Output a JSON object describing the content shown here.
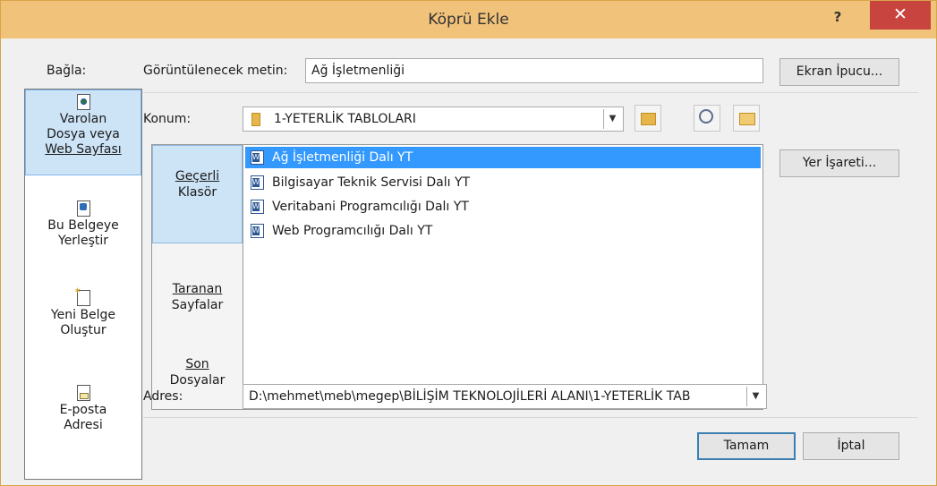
{
  "window": {
    "title": "Köprü Ekle",
    "help_label": "?",
    "close_label": "✕"
  },
  "link_to": {
    "heading": "Bağla:",
    "items": [
      {
        "line1": "Varolan",
        "line2": "Dosya veya",
        "line3": "Web Sayfası",
        "icon": "existing-file-icon",
        "selected": true
      },
      {
        "line1": "Bu Belgeye",
        "line2": "Yerleştir",
        "icon": "place-in-document-icon"
      },
      {
        "line1": "Yeni Belge",
        "line2": "Oluştur",
        "icon": "new-document-icon"
      },
      {
        "line1": "E-posta",
        "line2": "Adresi",
        "icon": "email-icon"
      }
    ]
  },
  "display_text": {
    "label": "Görüntülenecek metin:",
    "value": "Ağ İşletmenliği"
  },
  "screen_tip_button": "Ekran İpucu...",
  "look_in": {
    "label": "Konum:",
    "value": "1-YETERLİK TABLOLARI"
  },
  "browse_panel": {
    "items": [
      {
        "line1": "Geçerli",
        "line2": "Klasör",
        "selected": true
      },
      {
        "line1": "Taranan",
        "line2": "Sayfalar"
      },
      {
        "line1": "Son",
        "line2": "Dosyalar"
      }
    ]
  },
  "files": [
    {
      "name": "Ağ İşletmenliği Dalı YT",
      "selected": true
    },
    {
      "name": "Bilgisayar Teknik Servisi Dalı YT"
    },
    {
      "name": "Veritabani Programcılığı Dalı YT"
    },
    {
      "name": "Web Programcılığı Dalı YT"
    }
  ],
  "bookmark_button": "Yer İşareti...",
  "address": {
    "label": "Adres:",
    "value": "D:\\mehmet\\meb\\megep\\BİLİŞİM TEKNOLOJİLERİ ALANI\\1-YETERLİK TAB"
  },
  "ok_button": "Tamam",
  "cancel_button": "İptal",
  "colors": {
    "titlebar": "#f1c27a",
    "close": "#c7443f",
    "selection": "#3399ff",
    "nav_selected": "#cde4f7"
  }
}
